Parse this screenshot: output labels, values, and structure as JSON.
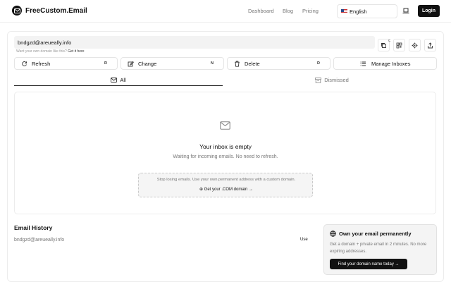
{
  "header": {
    "brand": "FreeCustom.Email",
    "nav": [
      "Dashboard",
      "Blog",
      "Pricing"
    ],
    "language": "English",
    "login_label": "Login"
  },
  "mailbox": {
    "address": "bndgzd@areueally.info",
    "hint_text": "Want your own domain like this?",
    "hint_link": "Get it here",
    "copy_badge": "C"
  },
  "actions": [
    {
      "label": "Refresh",
      "key": "R",
      "icon": "refresh-icon"
    },
    {
      "label": "Change",
      "key": "N",
      "icon": "edit-icon"
    },
    {
      "label": "Delete",
      "key": "D",
      "icon": "trash-icon"
    },
    {
      "label": "Manage Inboxes",
      "key": "",
      "icon": "list-icon"
    }
  ],
  "tabs": {
    "all": "All",
    "dismissed": "Dismissed"
  },
  "inbox": {
    "empty_title": "Your inbox is empty",
    "empty_sub": "Waiting for incoming emails. No need to refresh.",
    "promo_text": "Stop losing emails. Use your own permanent address with a custom domain.",
    "promo_link": "Get your .COM domain →"
  },
  "history": {
    "title": "Email History",
    "items": [
      {
        "email": "bndgzd@areueally.info",
        "action": "Use"
      }
    ]
  },
  "own_panel": {
    "title": "Own your email permanently",
    "desc": "Get a domain + private email in 2 minutes. No more expiring addresses.",
    "button": "Find your domain name today →"
  },
  "colors": {
    "primary": "#111111",
    "muted": "#777777",
    "border": "#e5e5e5",
    "panel": "#f4f4f4"
  }
}
